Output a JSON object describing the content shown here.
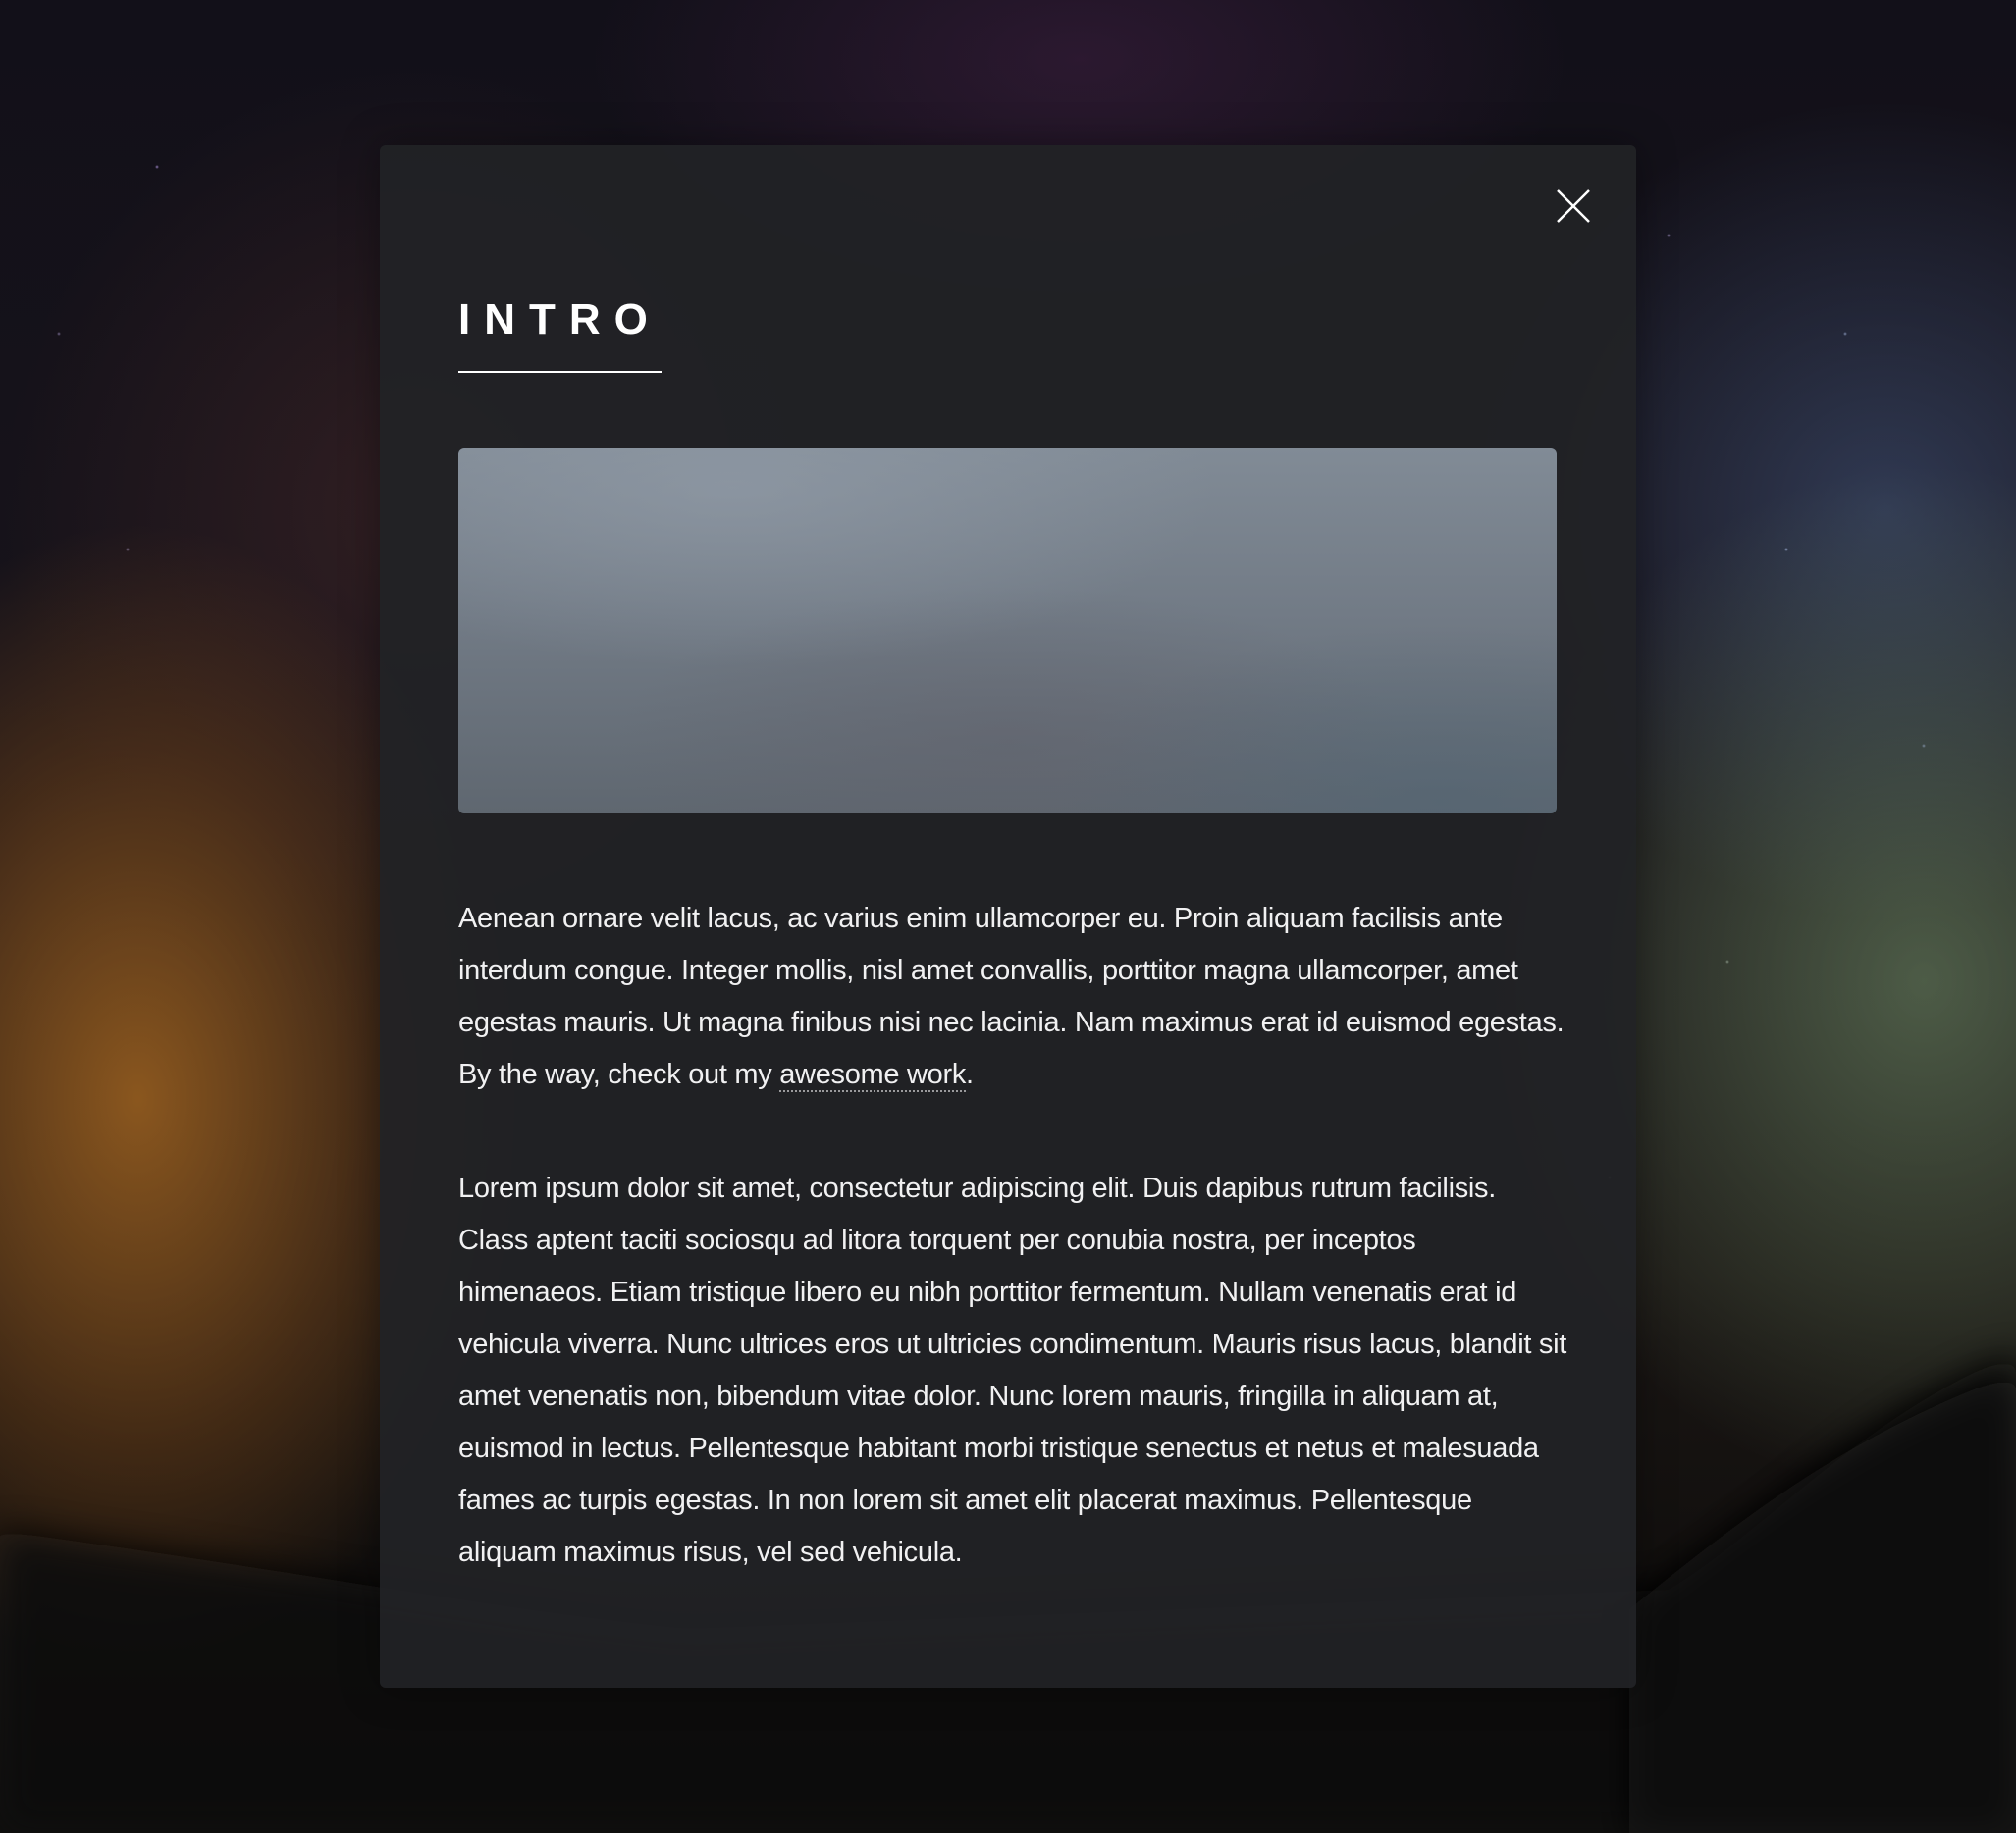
{
  "modal": {
    "title": "INTRO",
    "close_icon": "close-icon",
    "paragraphs": [
      {
        "text_before_link": "Aenean ornare velit lacus, ac varius enim ullamcorper eu. Proin aliquam facilisis ante interdum congue. Integer mollis, nisl amet convallis, porttitor magna ullamcorper, amet egestas mauris. Ut magna finibus nisi nec lacinia. Nam maximus erat id euismod egestas. By the way, check out my ",
        "link_text": "awesome work",
        "text_after_link": "."
      },
      {
        "text": "Lorem ipsum dolor sit amet, consectetur adipiscing elit. Duis dapibus rutrum facilisis. Class aptent taciti sociosqu ad litora torquent per conubia nostra, per inceptos himenaeos. Etiam tristique libero eu nibh porttitor fermentum. Nullam venenatis erat id vehicula viverra. Nunc ultrices eros ut ultricies condimentum. Mauris risus lacus, blandit sit amet venenatis non, bibendum vitae dolor. Nunc lorem mauris, fringilla in aliquam at, euismod in lectus. Pellentesque habitant morbi tristique senectus et netus et malesuada fames ac turpis egestas. In non lorem sit amet elit placerat maximus. Pellentesque aliquam maximus risus, vel sed vehicula."
      }
    ]
  },
  "colors": {
    "modal_background": "#212226",
    "text": "#f1f1f2",
    "title": "#ffffff"
  }
}
